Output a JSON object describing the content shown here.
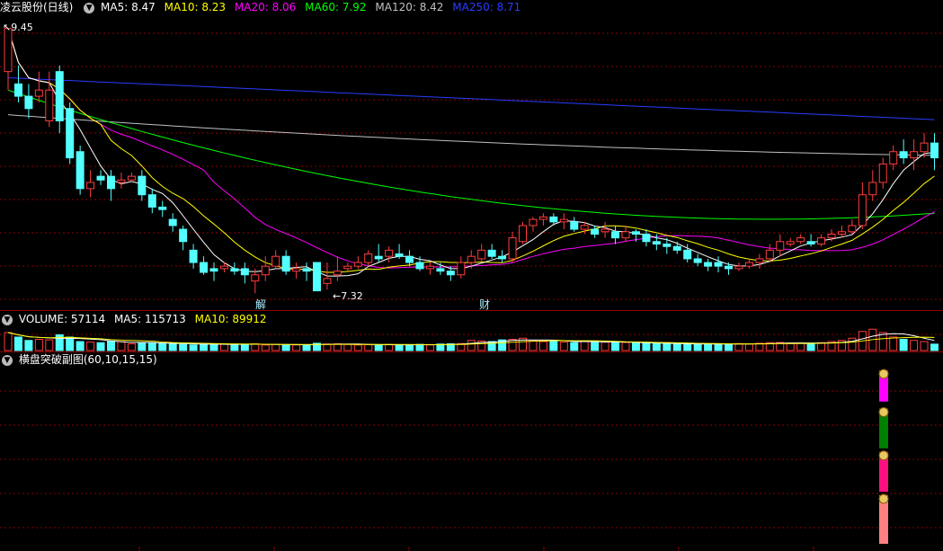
{
  "header": {
    "stock": "凌云股份(日线)",
    "ma5": "MA5: 8.47",
    "ma10": "MA10: 8.23",
    "ma20": "MA20: 8.06",
    "ma60": "MA60: 7.92",
    "ma120": "MA120: 8.42",
    "ma250": "MA250: 8.71"
  },
  "volume_header": {
    "volume": "VOLUME: 57114",
    "ma5": "MA5: 115713",
    "ma10": "MA10: 89912"
  },
  "indicator_header": {
    "title": "横盘突破副图(60,10,15,15)"
  },
  "colors": {
    "up": "#ff3c3c",
    "down": "#54ffff",
    "ma5": "#ffffff",
    "ma10": "#ffff00",
    "ma20": "#ff00ff",
    "ma60": "#00ff00",
    "ma120": "#c0c0c0",
    "ma250": "#2a3cff",
    "grid": "#8a0000"
  },
  "chart_data": {
    "type": "candlestick",
    "annotations": {
      "high_label": "9.45",
      "low_label": "7.32",
      "event1": "解",
      "event2": "财"
    },
    "price_range": [
      7.2,
      9.55
    ],
    "candles": [
      [
        9.1,
        9.45,
        9.45,
        8.95
      ],
      [
        9.0,
        8.9,
        9.15,
        8.85
      ],
      [
        8.9,
        8.8,
        9.0,
        8.72
      ],
      [
        8.9,
        8.95,
        9.1,
        8.85
      ],
      [
        8.7,
        8.95,
        9.1,
        8.65
      ],
      [
        9.1,
        8.7,
        9.15,
        8.6
      ],
      [
        8.8,
        8.4,
        8.85,
        8.35
      ],
      [
        8.45,
        8.15,
        8.5,
        8.1
      ],
      [
        8.15,
        8.2,
        8.3,
        8.08
      ],
      [
        8.25,
        8.22,
        8.3,
        8.18
      ],
      [
        8.25,
        8.15,
        8.3,
        8.05
      ],
      [
        8.2,
        8.22,
        8.28,
        8.15
      ],
      [
        8.22,
        8.25,
        8.28,
        8.2
      ],
      [
        8.25,
        8.1,
        8.3,
        8.05
      ],
      [
        8.1,
        8.0,
        8.15,
        7.95
      ],
      [
        8.0,
        7.98,
        8.05,
        7.92
      ],
      [
        7.9,
        7.85,
        7.95,
        7.8
      ],
      [
        7.82,
        7.72,
        7.85,
        7.65
      ],
      [
        7.65,
        7.55,
        7.7,
        7.5
      ],
      [
        7.55,
        7.47,
        7.6,
        7.45
      ],
      [
        7.5,
        7.48,
        7.55,
        7.4
      ],
      [
        7.5,
        7.52,
        7.55,
        7.47
      ],
      [
        7.5,
        7.48,
        7.55,
        7.45
      ],
      [
        7.5,
        7.45,
        7.55,
        7.38
      ],
      [
        7.4,
        7.45,
        7.5,
        7.3
      ],
      [
        7.45,
        7.52,
        7.6,
        7.4
      ],
      [
        7.52,
        7.6,
        7.65,
        7.5
      ],
      [
        7.6,
        7.48,
        7.65,
        7.45
      ],
      [
        7.48,
        7.5,
        7.55,
        7.42
      ],
      [
        7.5,
        7.48,
        7.55,
        7.4
      ],
      [
        7.55,
        7.32,
        7.55,
        7.32
      ],
      [
        7.38,
        7.42,
        7.55,
        7.33
      ],
      [
        7.45,
        7.48,
        7.6,
        7.4
      ],
      [
        7.5,
        7.52,
        7.55,
        7.48
      ],
      [
        7.52,
        7.55,
        7.6,
        7.5
      ],
      [
        7.55,
        7.62,
        7.65,
        7.52
      ],
      [
        7.6,
        7.58,
        7.7,
        7.55
      ],
      [
        7.6,
        7.65,
        7.68,
        7.55
      ],
      [
        7.62,
        7.6,
        7.7,
        7.58
      ],
      [
        7.6,
        7.55,
        7.65,
        7.52
      ],
      [
        7.55,
        7.5,
        7.6,
        7.48
      ],
      [
        7.5,
        7.52,
        7.55,
        7.45
      ],
      [
        7.5,
        7.48,
        7.55,
        7.45
      ],
      [
        7.48,
        7.45,
        7.52,
        7.4
      ],
      [
        7.45,
        7.55,
        7.6,
        7.42
      ],
      [
        7.55,
        7.6,
        7.65,
        7.5
      ],
      [
        7.58,
        7.65,
        7.7,
        7.55
      ],
      [
        7.65,
        7.6,
        7.7,
        7.58
      ],
      [
        7.6,
        7.58,
        7.65,
        7.55
      ],
      [
        7.58,
        7.75,
        7.8,
        7.55
      ],
      [
        7.72,
        7.85,
        7.88,
        7.7
      ],
      [
        7.85,
        7.9,
        7.92,
        7.8
      ],
      [
        7.9,
        7.92,
        7.95,
        7.85
      ],
      [
        7.92,
        7.88,
        7.95,
        7.85
      ],
      [
        7.88,
        7.9,
        7.95,
        7.82
      ],
      [
        7.88,
        7.82,
        7.92,
        7.8
      ],
      [
        7.82,
        7.85,
        7.88,
        7.78
      ],
      [
        7.82,
        7.78,
        7.85,
        7.75
      ],
      [
        7.8,
        7.82,
        7.88,
        7.75
      ],
      [
        7.8,
        7.75,
        7.85,
        7.7
      ],
      [
        7.75,
        7.8,
        7.85,
        7.72
      ],
      [
        7.8,
        7.78,
        7.82,
        7.72
      ],
      [
        7.78,
        7.72,
        7.82,
        7.68
      ],
      [
        7.72,
        7.7,
        7.78,
        7.65
      ],
      [
        7.7,
        7.68,
        7.75,
        7.62
      ],
      [
        7.68,
        7.65,
        7.72,
        7.62
      ],
      [
        7.65,
        7.58,
        7.7,
        7.55
      ],
      [
        7.58,
        7.55,
        7.62,
        7.52
      ],
      [
        7.55,
        7.52,
        7.58,
        7.48
      ],
      [
        7.55,
        7.52,
        7.6,
        7.47
      ],
      [
        7.52,
        7.5,
        7.55,
        7.45
      ],
      [
        7.5,
        7.52,
        7.55,
        7.48
      ],
      [
        7.52,
        7.55,
        7.58,
        7.5
      ],
      [
        7.55,
        7.58,
        7.62,
        7.5
      ],
      [
        7.58,
        7.65,
        7.7,
        7.55
      ],
      [
        7.65,
        7.72,
        7.78,
        7.6
      ],
      [
        7.7,
        7.72,
        7.75,
        7.68
      ],
      [
        7.72,
        7.75,
        7.78,
        7.7
      ],
      [
        7.72,
        7.7,
        7.78,
        7.68
      ],
      [
        7.7,
        7.75,
        7.78,
        7.68
      ],
      [
        7.75,
        7.78,
        7.82,
        7.72
      ],
      [
        7.78,
        7.8,
        7.85,
        7.75
      ],
      [
        7.8,
        7.85,
        7.9,
        7.78
      ],
      [
        7.85,
        8.1,
        8.2,
        7.82
      ],
      [
        8.1,
        8.2,
        8.3,
        8.05
      ],
      [
        8.2,
        8.35,
        8.4,
        8.15
      ],
      [
        8.35,
        8.45,
        8.5,
        8.3
      ],
      [
        8.45,
        8.4,
        8.55,
        8.35
      ],
      [
        8.4,
        8.45,
        8.55,
        8.3
      ],
      [
        8.45,
        8.52,
        8.6,
        8.4
      ],
      [
        8.52,
        8.4,
        8.6,
        8.3
      ]
    ],
    "volume_range": [
      0,
      200000
    ],
    "volumes": [
      160000,
      120000,
      90000,
      100000,
      95000,
      140000,
      120000,
      80000,
      75000,
      70000,
      85000,
      80000,
      60000,
      65000,
      70000,
      60000,
      65000,
      55000,
      50000,
      55000,
      60000,
      58000,
      50000,
      55000,
      60000,
      50000,
      55000,
      48000,
      50000,
      52000,
      65000,
      58000,
      60000,
      55000,
      50000,
      52000,
      48000,
      55000,
      50000,
      52000,
      55000,
      50000,
      58000,
      60000,
      62000,
      90000,
      85000,
      80000,
      95000,
      100000,
      110000,
      85000,
      80000,
      90000,
      75000,
      70000,
      85000,
      80000,
      75000,
      70000,
      72000,
      68000,
      65000,
      60000,
      62000,
      58000,
      60000,
      55000,
      58000,
      60000,
      55000,
      62000,
      58000,
      65000,
      70000,
      72000,
      68000,
      65000,
      60000,
      70000,
      80000,
      90000,
      110000,
      170000,
      190000,
      160000,
      120000,
      100000,
      90000,
      80000,
      57114
    ],
    "signal_blocks": [
      {
        "color": "#ff00ff",
        "from": 0.82,
        "to": 1.0
      },
      {
        "color": "#008000",
        "from": 0.55,
        "to": 0.78
      },
      {
        "color": "#ff0f80",
        "from": 0.3,
        "to": 0.53
      },
      {
        "color": "#ff8080",
        "from": 0.0,
        "to": 0.28
      }
    ]
  }
}
